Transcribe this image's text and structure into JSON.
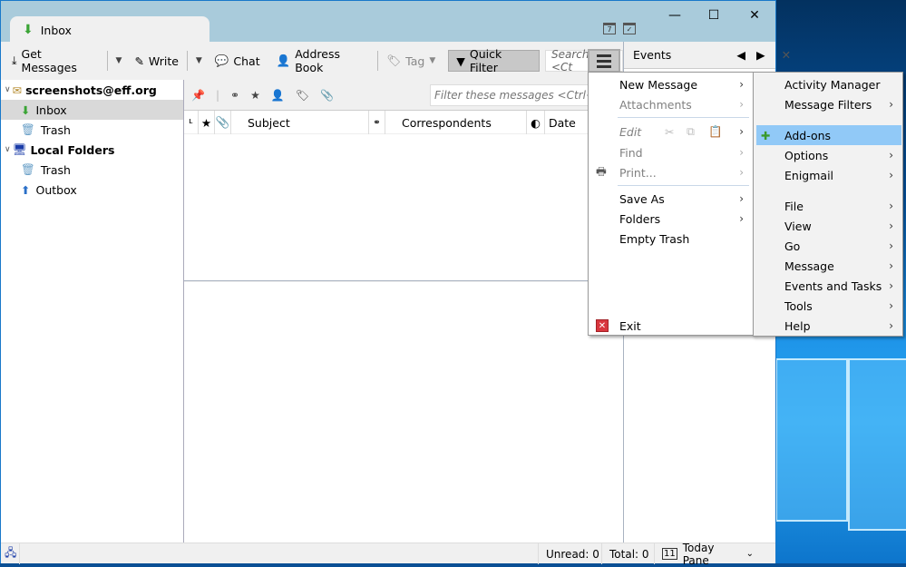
{
  "window": {
    "tab_title": "Inbox",
    "controls": {
      "minimize": "—",
      "maximize": "☐",
      "close": "✕"
    },
    "calendar_icons": [
      "calendar-icon",
      "tasks-icon"
    ]
  },
  "toolbar": {
    "get_messages": "Get Messages",
    "write": "Write",
    "chat": "Chat",
    "address_book": "Address Book",
    "tag": "Tag",
    "quick_filter": "Quick Filter",
    "search_placeholder": "Search <Ct"
  },
  "sidebar": {
    "accounts": [
      {
        "name": "screenshots@eff.org",
        "folders": [
          "Inbox",
          "Trash"
        ]
      },
      {
        "name": "Local Folders",
        "folders": [
          "Trash",
          "Outbox"
        ]
      }
    ],
    "selected": "Inbox"
  },
  "thread_pane": {
    "filter_placeholder": "Filter these messages <Ctrl+Shif",
    "columns": [
      "Subject",
      "Correspondents",
      "Date"
    ]
  },
  "today_pane": {
    "title": "Events"
  },
  "statusbar": {
    "unread": "Unread: 0",
    "total": "Total: 0",
    "today_pane": "Today Pane"
  },
  "app_menu": {
    "left": [
      {
        "label": "New Message",
        "submenu": true,
        "disabled": false
      },
      {
        "label": "Attachments",
        "submenu": true,
        "disabled": true
      },
      {
        "label": "Edit",
        "submenu": true,
        "disabled": true
      },
      {
        "label": "Find",
        "submenu": true,
        "disabled": true
      },
      {
        "label": "Print...",
        "submenu": true,
        "disabled": true
      },
      {
        "label": "Save As",
        "submenu": true,
        "disabled": false
      },
      {
        "label": "Folders",
        "submenu": true,
        "disabled": false
      },
      {
        "label": "Empty Trash",
        "submenu": false,
        "disabled": false
      },
      {
        "label": "Exit",
        "submenu": false,
        "disabled": false
      }
    ],
    "right": [
      {
        "label": "Activity Manager",
        "submenu": false
      },
      {
        "label": "Message Filters",
        "submenu": true
      },
      {
        "label": "Add-ons",
        "submenu": false,
        "highlighted": true
      },
      {
        "label": "Options",
        "submenu": true
      },
      {
        "label": "Enigmail",
        "submenu": true
      },
      {
        "label": "File",
        "submenu": true
      },
      {
        "label": "View",
        "submenu": true
      },
      {
        "label": "Go",
        "submenu": true
      },
      {
        "label": "Message",
        "submenu": true
      },
      {
        "label": "Events and Tasks",
        "submenu": true
      },
      {
        "label": "Tools",
        "submenu": true
      },
      {
        "label": "Help",
        "submenu": true
      }
    ]
  },
  "colors": {
    "titlebar": "#a9cbdb",
    "highlight": "#91c9f7",
    "selected_folder": "#d9d9d9"
  }
}
